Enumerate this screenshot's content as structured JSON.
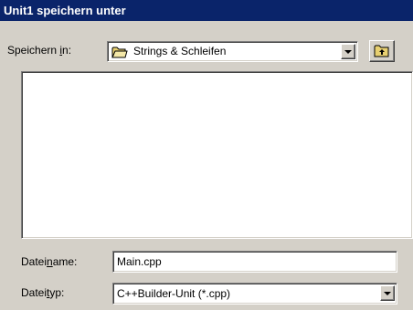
{
  "window": {
    "title": "Unit1 speichern unter"
  },
  "save_in": {
    "label_before": "Speichern ",
    "label_underlined": "i",
    "label_after": "n:",
    "value": "Strings & Schleifen",
    "folder_icon": "folder-icon"
  },
  "up_folder_button": {
    "icon": "up-folder-icon"
  },
  "file_list": {
    "items": []
  },
  "filename": {
    "label_before": "Datei",
    "label_underlined": "n",
    "label_after": "ame:",
    "value": "Main.cpp"
  },
  "filetype": {
    "label_before": "Datei",
    "label_underlined": "t",
    "label_after": "yp:",
    "value": "C++Builder-Unit (*.cpp)"
  }
}
